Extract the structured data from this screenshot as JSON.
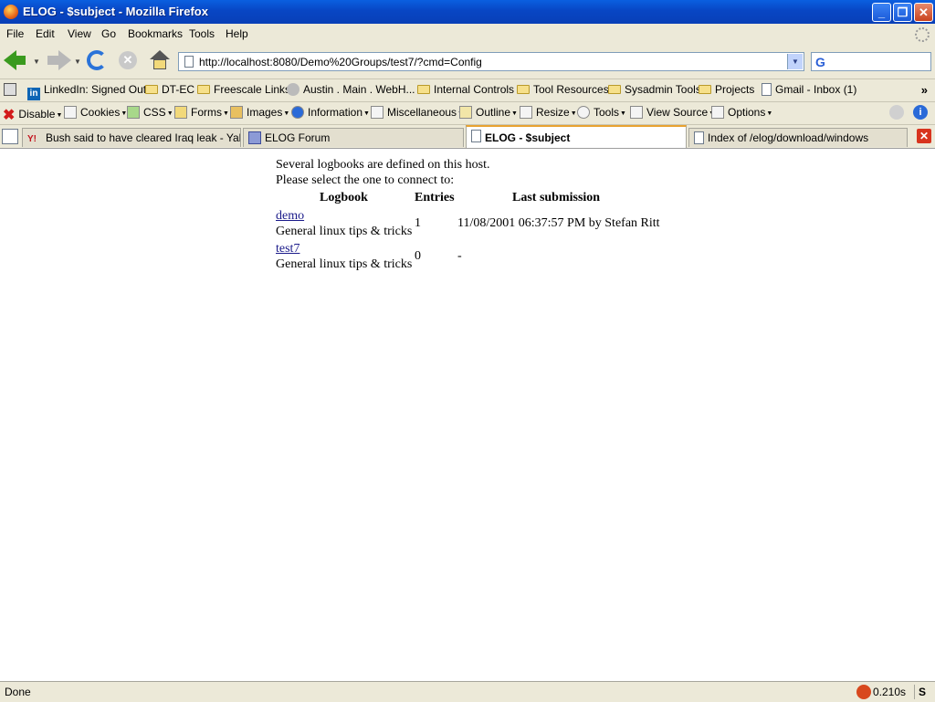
{
  "window": {
    "title": "ELOG - $subject - Mozilla Firefox"
  },
  "menubar": {
    "items": [
      {
        "label": "File"
      },
      {
        "label": "Edit"
      },
      {
        "label": "View"
      },
      {
        "label": "Go"
      },
      {
        "label": "Bookmarks"
      },
      {
        "label": "Tools"
      },
      {
        "label": "Help"
      }
    ]
  },
  "navigation": {
    "url": "http://localhost:8080/Demo%20Groups/test7/?cmd=Config",
    "search_value": ""
  },
  "bookmarks": [
    {
      "label": "LinkedIn: Signed Out",
      "icon": "linkedin-icon"
    },
    {
      "label": "DT-EC",
      "icon": "folder-icon"
    },
    {
      "label": "Freescale Links",
      "icon": "folder-icon"
    },
    {
      "label": "Austin . Main . WebH...",
      "icon": "webhome-icon"
    },
    {
      "label": "Internal Controls",
      "icon": "folder-icon"
    },
    {
      "label": "Tool Resources",
      "icon": "folder-icon"
    },
    {
      "label": "Sysadmin Tools",
      "icon": "folder-icon"
    },
    {
      "label": "Projects",
      "icon": "folder-icon"
    },
    {
      "label": "Gmail - Inbox (1)",
      "icon": "page-icon"
    }
  ],
  "devtoolbar": [
    {
      "label": "Disable"
    },
    {
      "label": "Cookies"
    },
    {
      "label": "CSS"
    },
    {
      "label": "Forms"
    },
    {
      "label": "Images"
    },
    {
      "label": "Information"
    },
    {
      "label": "Miscellaneous"
    },
    {
      "label": "Outline"
    },
    {
      "label": "Resize"
    },
    {
      "label": "Tools"
    },
    {
      "label": "View Source"
    },
    {
      "label": "Options"
    }
  ],
  "tabs": [
    {
      "label": "Bush said to have cleared Iraq leak - Yaho...",
      "active": false
    },
    {
      "label": "ELOG Forum",
      "active": false
    },
    {
      "label": "ELOG - $subject",
      "active": true
    },
    {
      "label": "Index of /elog/download/windows",
      "active": false
    }
  ],
  "content": {
    "intro_line1": "Several logbooks are defined on this host.",
    "intro_line2": "Please select the one to connect to:",
    "headers": {
      "logbook": "Logbook",
      "entries": "Entries",
      "last": "Last submission"
    },
    "logbooks": [
      {
        "name": "demo",
        "description": "General linux tips & tricks",
        "entries": "1",
        "last": "11/08/2001 06:37:57 PM by Stefan Ritt"
      },
      {
        "name": "test7",
        "description": "General linux tips & tricks",
        "entries": "0",
        "last": "-"
      }
    ]
  },
  "status": {
    "text": "Done",
    "time": "0.210s"
  }
}
